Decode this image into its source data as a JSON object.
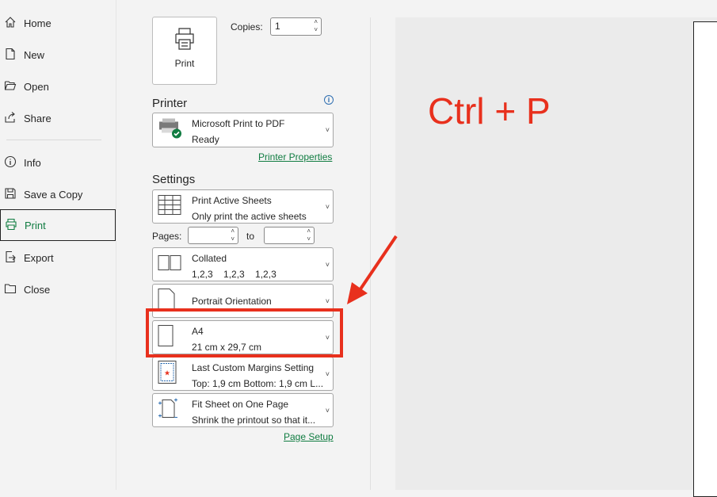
{
  "sidebar": {
    "items": [
      {
        "label": "Home",
        "icon": "home-icon"
      },
      {
        "label": "New",
        "icon": "new-document-icon"
      },
      {
        "label": "Open",
        "icon": "open-folder-icon"
      },
      {
        "label": "Share",
        "icon": "share-icon"
      },
      {
        "label": "Info",
        "icon": "info-icon"
      },
      {
        "label": "Save a Copy",
        "icon": "save-icon"
      },
      {
        "label": "Print",
        "icon": "printer-icon",
        "active": true
      },
      {
        "label": "Export",
        "icon": "export-icon"
      },
      {
        "label": "Close",
        "icon": "folder-close-icon"
      }
    ]
  },
  "print": {
    "button_label": "Print",
    "copies_label": "Copies:",
    "copies_value": "1"
  },
  "printer": {
    "section_title": "Printer",
    "name": "Microsoft Print to PDF",
    "status": "Ready",
    "properties_link": "Printer Properties"
  },
  "settings": {
    "section_title": "Settings",
    "scope": {
      "title": "Print Active Sheets",
      "subtitle": "Only print the active sheets"
    },
    "pages_label": "Pages:",
    "to_label": "to",
    "pages_from": "",
    "pages_to": "",
    "collation": {
      "title": "Collated",
      "subtitle": "1,2,3    1,2,3    1,2,3"
    },
    "orientation": {
      "title": "Portrait Orientation"
    },
    "paper": {
      "title": "A4",
      "subtitle": "21 cm x 29,7 cm"
    },
    "margins": {
      "title": "Last Custom Margins Setting",
      "subtitle": "Top: 1,9 cm Bottom: 1,9 cm L..."
    },
    "scaling": {
      "title": "Fit Sheet on One Page",
      "subtitle": "Shrink the printout so that it..."
    },
    "page_setup_link": "Page Setup"
  },
  "annotation": {
    "text": "Ctrl + P",
    "color": "#e8301d"
  },
  "colors": {
    "accent": "#107c41",
    "annotation_red": "#e8301d"
  }
}
